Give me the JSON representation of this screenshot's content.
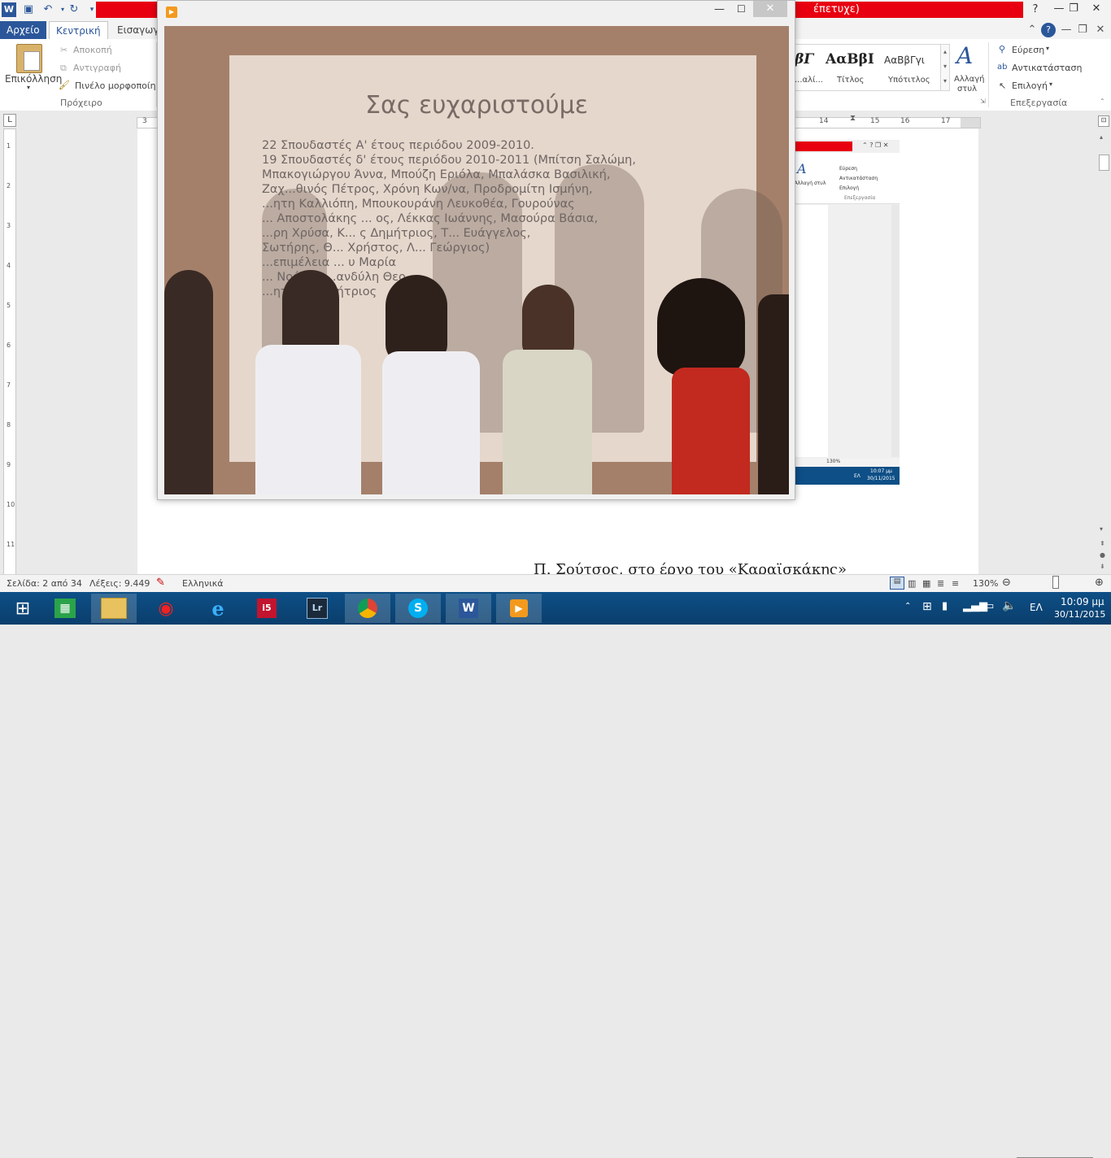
{
  "word": {
    "title_fragment": "έπετυχε)",
    "tabs": [
      "Αρχείο",
      "Κεντρική",
      "Εισαγωγή"
    ],
    "clipboard": {
      "paste": "Επικόλληση",
      "cut": "Αποκοπή",
      "copy": "Αντιγραφή",
      "format_painter": "Πινέλο μορφοποίησης",
      "group": "Πρόχειρο"
    },
    "styles": {
      "items": [
        {
          "preview": "βΓ",
          "label": "...αλί..."
        },
        {
          "preview": "ΑαΒβΙ",
          "label": "Τίτλος"
        },
        {
          "preview": "ΑαΒβΓγι",
          "label": "Υπότιτλος"
        }
      ],
      "change": "Αλλαγή στυλ"
    },
    "editing": {
      "find": "Εύρεση",
      "replace": "Αντικατάσταση",
      "select": "Επιλογή",
      "group": "Επεξεργασία"
    },
    "ruler_numbers": [
      "3",
      "14",
      "15",
      "16",
      "17"
    ],
    "vruler_numbers": [
      "1",
      "2",
      "3",
      "4",
      "5",
      "6",
      "7",
      "8",
      "9",
      "10",
      "11"
    ],
    "doc_text": "Π. Σούτσος, στο έργο του «Καραϊσκάκης»",
    "status": {
      "page": "Σελίδα: 2 από 34",
      "words": "Λέξεις: 9.449",
      "language": "Ελληνικά",
      "zoom": "130%"
    }
  },
  "player": {
    "slide": {
      "title": "Σας ευχαριστούμε",
      "bullets": [
        "22 Σπουδαστές Α' έτους περιόδου 2009-2010.",
        "19 Σπουδαστές δ' έτους περιόδου 2010-2011 (Μπίτση Σαλώμη,",
        "Μπακογιώργου Άννα, Μπούζη Εριόλα, Μπαλάσκα Βασιλική,",
        "Ζαχ...θινός Πέτρος, Χρόνη Κων/να, Προδρομίτη Ισμήνη,",
        "...ητη Καλλιόπη, Μπουκουράνη Λευκοθέα, Γουρούνας",
        "... Αποστολάκης ... ος, Λέκκας Ιωάννης, Μασούρα Βάσια,",
        "...ρη Χρύσα, Κ... ς Δημήτριος, Τ... Ευάγγελος,",
        "Σωτήρης, Θ... Χρήστος, Λ... Γεώργιος)",
        "...επιμέλεια ... υ Μαρία",
        "... Noέλ ... ...ανδύλη Θεο...",
        "...ητ... ... ...μήτριος"
      ]
    }
  },
  "mini": {
    "find": "Εύρεση",
    "replace": "Αντικατάσταση",
    "select": "Επιλογή",
    "change": "Αλλαγή στυλ",
    "group": "Επεξεργασία",
    "zoom": "130%",
    "lang": "ΕΛ",
    "time": "10:07 μμ",
    "date": "30/11/2015"
  },
  "taskbar": {
    "lang": "ΕΛ",
    "time": "10:09 μμ",
    "date": "30/11/2015",
    "apps": [
      "start",
      "store",
      "file-explorer",
      "media-app",
      "internet-explorer",
      "i5",
      "lightroom",
      "chrome",
      "skype",
      "word",
      "media-player"
    ]
  },
  "colors": {
    "word_blue": "#2b579a",
    "title_red": "#e80010",
    "taskbar": "#0d4f86"
  }
}
